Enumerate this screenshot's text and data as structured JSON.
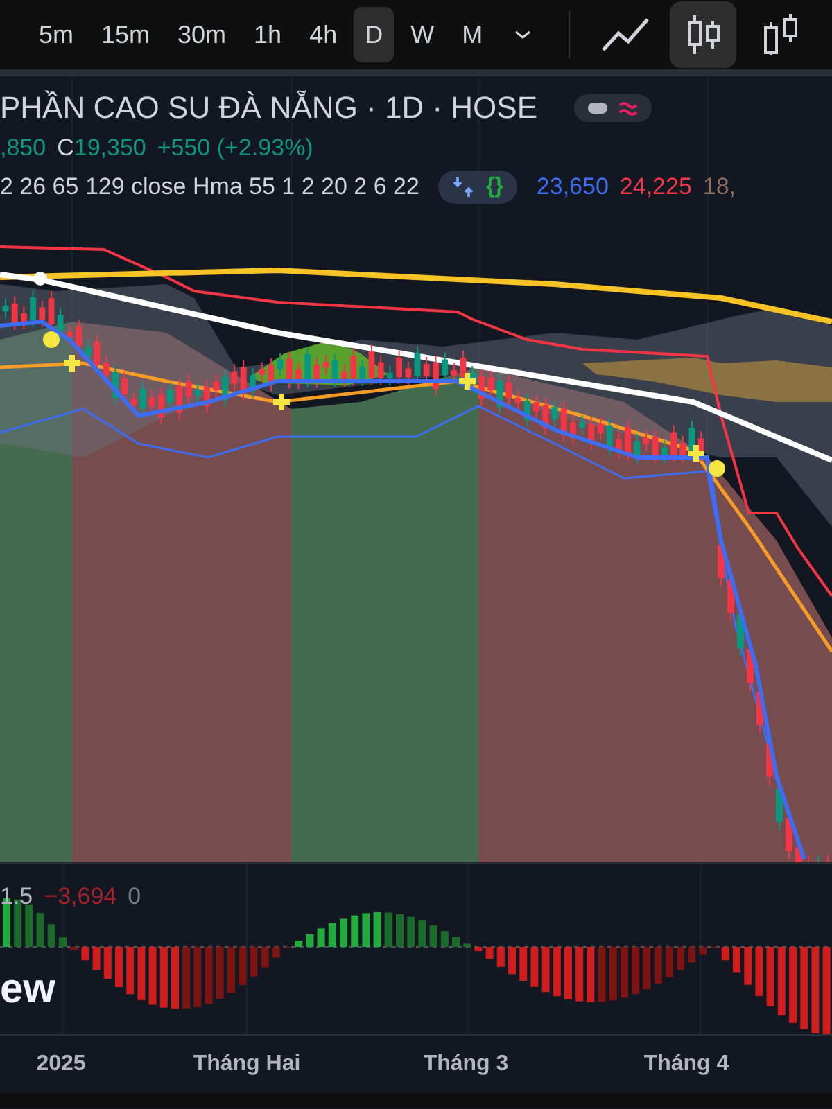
{
  "toolbar": {
    "intervals": [
      {
        "label": "5m",
        "selected": false
      },
      {
        "label": "15m",
        "selected": false
      },
      {
        "label": "30m",
        "selected": false
      },
      {
        "label": "1h",
        "selected": false
      },
      {
        "label": "4h",
        "selected": false
      },
      {
        "label": "D",
        "selected": true
      },
      {
        "label": "W",
        "selected": false
      },
      {
        "label": "M",
        "selected": false
      }
    ],
    "chart_types": [
      {
        "kind": "line",
        "selected": false
      },
      {
        "kind": "candles",
        "selected": true
      },
      {
        "kind": "hollow",
        "selected": false
      }
    ]
  },
  "legend": {
    "toggle_on": true,
    "title": "PHẦN CAO SU ĐÀ NẴNG · 1D · HOSE",
    "open_value": ",850",
    "close_label": "C",
    "close_value": "19,350",
    "change": "+550 (+2.93%)",
    "indicator_params": "2 26 65 129 close Hma 55 1 2 20 2 6 22",
    "code_glyph": "{}",
    "indicator_values": [
      {
        "text": "23,650",
        "color": "#3d6df2"
      },
      {
        "text": "24,225",
        "color": "#f23645"
      },
      {
        "text": "18,",
        "color": "#8d6e63"
      }
    ]
  },
  "oscillator": {
    "values": [
      {
        "text": "1.5",
        "color": "#b2b5be"
      },
      {
        "text": "−3,694",
        "color": "#a3222c"
      },
      {
        "text": "0",
        "color": "#787b86"
      }
    ]
  },
  "logo_text": "ew",
  "time_axis": [
    "2025",
    "Tháng Hai",
    "Tháng 3",
    "Tháng 4"
  ]
}
